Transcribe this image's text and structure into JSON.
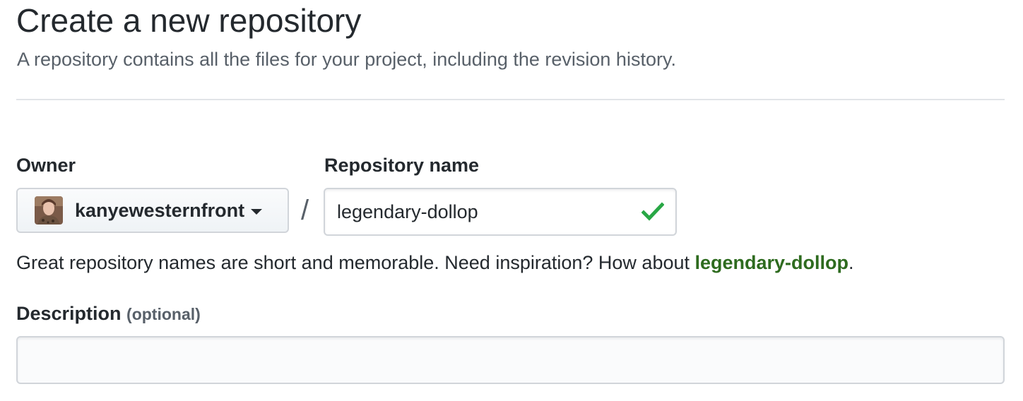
{
  "header": {
    "title": "Create a new repository",
    "subtitle": "A repository contains all the files for your project, including the revision history."
  },
  "owner": {
    "label": "Owner",
    "selected": "kanyewesternfront",
    "avatar_icon": "user-avatar"
  },
  "separator": "/",
  "repository": {
    "label": "Repository name",
    "value": "legendary-dollop",
    "status_icon": "check-icon",
    "status_color": "#28a745"
  },
  "hint": {
    "prefix": "Great repository names are short and memorable. Need inspiration? How about ",
    "suggestion": "legendary-dollop",
    "suffix": "."
  },
  "description": {
    "label": "Description",
    "optional": "(optional)",
    "value": "",
    "placeholder": ""
  },
  "colors": {
    "link_green": "#2e6b1f",
    "text": "#24292e",
    "muted": "#586069",
    "border": "#d1d5da"
  }
}
